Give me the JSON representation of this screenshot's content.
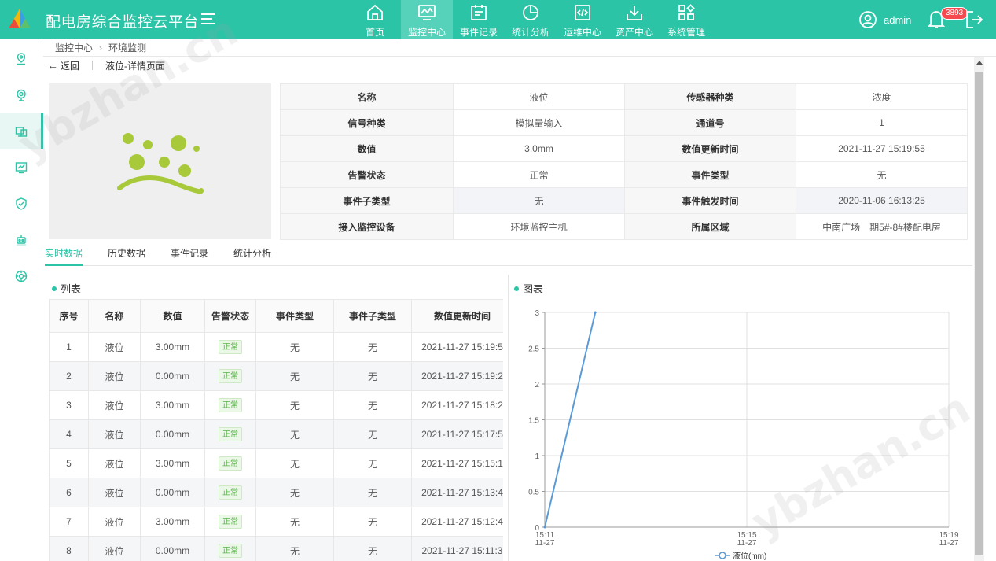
{
  "header": {
    "app_title": "配电房综合监控云平台",
    "nav": [
      {
        "label": "首页",
        "icon": "home-icon"
      },
      {
        "label": "监控中心",
        "icon": "monitor-icon"
      },
      {
        "label": "事件记录",
        "icon": "event-record-icon"
      },
      {
        "label": "统计分析",
        "icon": "statistics-icon"
      },
      {
        "label": "运维中心",
        "icon": "maintenance-icon"
      },
      {
        "label": "资产中心",
        "icon": "asset-icon"
      },
      {
        "label": "系统管理",
        "icon": "system-icon"
      }
    ],
    "active_nav": "监控中心",
    "user_name": "admin",
    "notification_count": "3893"
  },
  "sidebar": {
    "items": [
      "location-pin-icon",
      "camera-icon",
      "devices-icon",
      "chart-monitor-icon",
      "shield-check-icon",
      "robot-icon",
      "dial-icon"
    ],
    "active_index": 2
  },
  "breadcrumb": {
    "items": [
      "监控中心",
      "环境监测"
    ]
  },
  "detail_header": {
    "back_label": "返回",
    "page_title": "液位-详情页面"
  },
  "info": {
    "rows": [
      [
        {
          "k": "名称",
          "v": "液位"
        },
        {
          "k": "传感器种类",
          "v": "浓度"
        }
      ],
      [
        {
          "k": "信号种类",
          "v": "模拟量输入"
        },
        {
          "k": "通道号",
          "v": "1"
        }
      ],
      [
        {
          "k": "数值",
          "v": "3.0mm"
        },
        {
          "k": "数值更新时间",
          "v": "2021-11-27 15:19:55"
        }
      ],
      [
        {
          "k": "告警状态",
          "v": "正常"
        },
        {
          "k": "事件类型",
          "v": "无"
        }
      ],
      [
        {
          "k": "事件子类型",
          "v": "无"
        },
        {
          "k": "事件触发时间",
          "v": "2020-11-06 16:13:25"
        }
      ],
      [
        {
          "k": "接入监控设备",
          "v": "环境监控主机"
        },
        {
          "k": "所属区域",
          "v": "中南广场一期5#-8#楼配电房"
        }
      ]
    ]
  },
  "tabs": [
    "实时数据",
    "历史数据",
    "事件记录",
    "统计分析"
  ],
  "active_tab": "实时数据",
  "list_panel": {
    "title": "列表",
    "columns": [
      "序号",
      "名称",
      "数值",
      "告警状态",
      "事件类型",
      "事件子类型",
      "数值更新时间"
    ],
    "rows": [
      [
        "1",
        "液位",
        "3.00mm",
        "正常",
        "无",
        "无",
        "2021-11-27 15:19:5"
      ],
      [
        "2",
        "液位",
        "0.00mm",
        "正常",
        "无",
        "无",
        "2021-11-27 15:19:2"
      ],
      [
        "3",
        "液位",
        "3.00mm",
        "正常",
        "无",
        "无",
        "2021-11-27 15:18:2"
      ],
      [
        "4",
        "液位",
        "0.00mm",
        "正常",
        "无",
        "无",
        "2021-11-27 15:17:5"
      ],
      [
        "5",
        "液位",
        "3.00mm",
        "正常",
        "无",
        "无",
        "2021-11-27 15:15:1"
      ],
      [
        "6",
        "液位",
        "0.00mm",
        "正常",
        "无",
        "无",
        "2021-11-27 15:13:4"
      ],
      [
        "7",
        "液位",
        "3.00mm",
        "正常",
        "无",
        "无",
        "2021-11-27 15:12:4"
      ],
      [
        "8",
        "液位",
        "0.00mm",
        "正常",
        "无",
        "无",
        "2021-11-27 15:11:3"
      ]
    ]
  },
  "chart_panel": {
    "title": "图表"
  },
  "chart_data": {
    "type": "line",
    "x_ticks": [
      "15:11\n11-27",
      "15:15\n11-27",
      "15:19\n11-27"
    ],
    "y_ticks": [
      "0",
      "0.5",
      "1",
      "1.5",
      "2",
      "2.5",
      "3"
    ],
    "ylim": [
      0,
      3
    ],
    "series": [
      {
        "name": "液位(mm)",
        "color": "#5b9bd5",
        "points": [
          [
            "15:11",
            0
          ],
          [
            "15:12",
            3
          ]
        ]
      }
    ],
    "legend_position": "bottom-center",
    "grid": true
  },
  "watermark": [
    "ybzhan.cn",
    "ybzhan.cn"
  ],
  "colors": {
    "brand": "#2bc4a7",
    "status_normal": "#59b34a",
    "badge": "#f5484f"
  }
}
